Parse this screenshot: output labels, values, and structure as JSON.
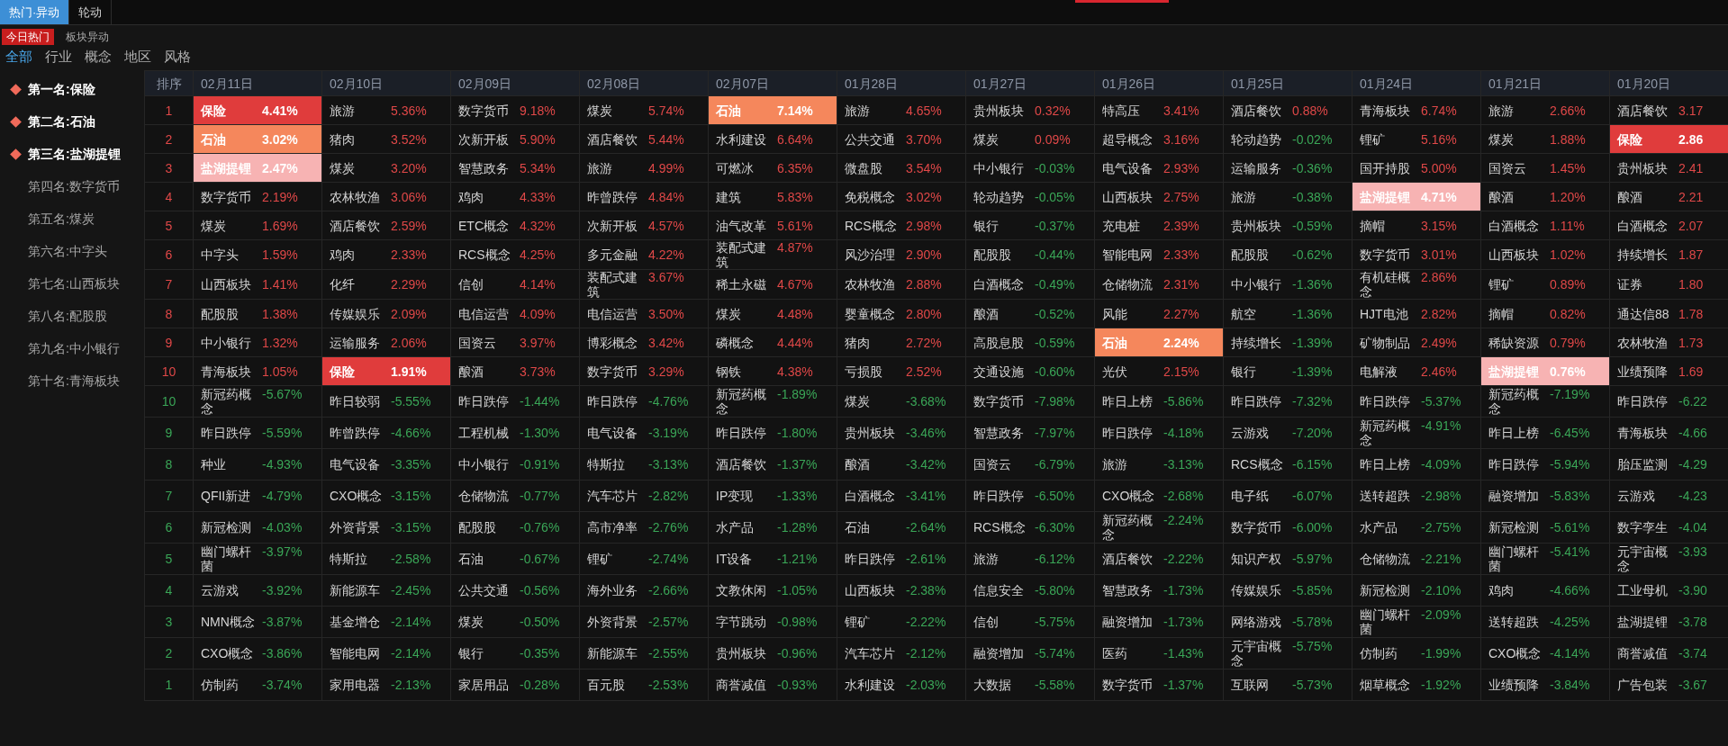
{
  "top_tabs": [
    {
      "label": "热门·异动",
      "selected": true
    },
    {
      "label": "轮动",
      "selected": false
    }
  ],
  "sub_tabs": [
    {
      "label": "今日热门",
      "selected": true
    },
    {
      "label": "板块异动",
      "selected": false
    }
  ],
  "filters": [
    {
      "label": "全部",
      "selected": true
    },
    {
      "label": "行业",
      "selected": false
    },
    {
      "label": "概念",
      "selected": false
    },
    {
      "label": "地区",
      "selected": false
    },
    {
      "label": "风格",
      "selected": false
    }
  ],
  "sidebar": {
    "items": [
      {
        "label": "第一名:保险",
        "highlighted": true
      },
      {
        "label": "第二名:石油",
        "highlighted": true
      },
      {
        "label": "第三名:盐湖提锂",
        "highlighted": true
      },
      {
        "label": "第四名:数字货币",
        "highlighted": false
      },
      {
        "label": "第五名:煤炭",
        "highlighted": false
      },
      {
        "label": "第六名:中字头",
        "highlighted": false
      },
      {
        "label": "第七名:山西板块",
        "highlighted": false
      },
      {
        "label": "第八名:配股股",
        "highlighted": false
      },
      {
        "label": "第九名:中小银行",
        "highlighted": false
      },
      {
        "label": "第十名:青海板块",
        "highlighted": false
      }
    ]
  },
  "table": {
    "rank_header": "排序",
    "columns": [
      "02月11日",
      "02月10日",
      "02月09日",
      "02月08日",
      "02月07日",
      "01月28日",
      "01月27日",
      "01月26日",
      "01月25日",
      "01月24日",
      "01月21日",
      "01月20日"
    ],
    "rows": [
      {
        "rank": "1",
        "kind": "gain",
        "cells": [
          {
            "name": "保险",
            "change": "4.41%",
            "color": "#e03c3c"
          },
          {
            "name": "旅游",
            "change": "5.36%",
            "rise": true
          },
          {
            "name": "数字货币",
            "change": "9.18%",
            "rise": true
          },
          {
            "name": "煤炭",
            "change": "5.74%",
            "rise": true
          },
          {
            "name": "石油",
            "change": "7.14%",
            "color": "#f5875c"
          },
          {
            "name": "旅游",
            "change": "4.65%",
            "rise": true
          },
          {
            "name": "贵州板块",
            "change": "0.32%",
            "rise": true
          },
          {
            "name": "特高压",
            "change": "3.41%",
            "rise": true
          },
          {
            "name": "酒店餐饮",
            "change": "0.88%",
            "rise": true
          },
          {
            "name": "青海板块",
            "change": "6.74%",
            "rise": true
          },
          {
            "name": "旅游",
            "change": "2.66%",
            "rise": true
          },
          {
            "name": "酒店餐饮",
            "change": "3.17",
            "rise": true
          }
        ]
      },
      {
        "rank": "2",
        "kind": "gain",
        "cells": [
          {
            "name": "石油",
            "change": "3.02%",
            "color": "#f5875c"
          },
          {
            "name": "猪肉",
            "change": "3.52%",
            "rise": true
          },
          {
            "name": "次新开板",
            "change": "5.90%",
            "rise": true
          },
          {
            "name": "酒店餐饮",
            "change": "5.44%",
            "rise": true
          },
          {
            "name": "水利建设",
            "change": "6.64%",
            "rise": true
          },
          {
            "name": "公共交通",
            "change": "3.70%",
            "rise": true
          },
          {
            "name": "煤炭",
            "change": "0.09%",
            "rise": true
          },
          {
            "name": "超导概念",
            "change": "3.16%",
            "rise": true
          },
          {
            "name": "轮动趋势",
            "change": "-0.02%",
            "rise": false
          },
          {
            "name": "锂矿",
            "change": "5.16%",
            "rise": true
          },
          {
            "name": "煤炭",
            "change": "1.88%",
            "rise": true
          },
          {
            "name": "保险",
            "change": "2.86",
            "color": "#e03c3c"
          }
        ]
      },
      {
        "rank": "3",
        "kind": "gain",
        "cells": [
          {
            "name": "盐湖提锂",
            "change": "2.47%",
            "color": "#f7b3b3"
          },
          {
            "name": "煤炭",
            "change": "3.20%",
            "rise": true
          },
          {
            "name": "智慧政务",
            "change": "5.34%",
            "rise": true
          },
          {
            "name": "旅游",
            "change": "4.99%",
            "rise": true
          },
          {
            "name": "可燃冰",
            "change": "6.35%",
            "rise": true
          },
          {
            "name": "微盘股",
            "change": "3.54%",
            "rise": true
          },
          {
            "name": "中小银行",
            "change": "-0.03%",
            "rise": false
          },
          {
            "name": "电气设备",
            "change": "2.93%",
            "rise": true
          },
          {
            "name": "运输服务",
            "change": "-0.36%",
            "rise": false
          },
          {
            "name": "国开持股",
            "change": "5.00%",
            "rise": true
          },
          {
            "name": "国资云",
            "change": "1.45%",
            "rise": true
          },
          {
            "name": "贵州板块",
            "change": "2.41",
            "rise": true
          }
        ]
      },
      {
        "rank": "4",
        "kind": "gain",
        "cells": [
          {
            "name": "数字货币",
            "change": "2.19%",
            "rise": true
          },
          {
            "name": "农林牧渔",
            "change": "3.06%",
            "rise": true
          },
          {
            "name": "鸡肉",
            "change": "4.33%",
            "rise": true
          },
          {
            "name": "昨曾跌停",
            "change": "4.84%",
            "rise": true
          },
          {
            "name": "建筑",
            "change": "5.83%",
            "rise": true
          },
          {
            "name": "免税概念",
            "change": "3.02%",
            "rise": true
          },
          {
            "name": "轮动趋势",
            "change": "-0.05%",
            "rise": false
          },
          {
            "name": "山西板块",
            "change": "2.75%",
            "rise": true
          },
          {
            "name": "旅游",
            "change": "-0.38%",
            "rise": false
          },
          {
            "name": "盐湖提锂",
            "change": "4.71%",
            "color": "#f7b3b3"
          },
          {
            "name": "酿酒",
            "change": "1.20%",
            "rise": true
          },
          {
            "name": "酿酒",
            "change": "2.21",
            "rise": true
          }
        ]
      },
      {
        "rank": "5",
        "kind": "gain",
        "cells": [
          {
            "name": "煤炭",
            "change": "1.69%",
            "rise": true
          },
          {
            "name": "酒店餐饮",
            "change": "2.59%",
            "rise": true
          },
          {
            "name": "ETC概念",
            "change": "4.32%",
            "rise": true
          },
          {
            "name": "次新开板",
            "change": "4.57%",
            "rise": true
          },
          {
            "name": "油气改革",
            "change": "5.61%",
            "rise": true
          },
          {
            "name": "RCS概念",
            "change": "2.98%",
            "rise": true
          },
          {
            "name": "银行",
            "change": "-0.37%",
            "rise": false
          },
          {
            "name": "充电桩",
            "change": "2.39%",
            "rise": true
          },
          {
            "name": "贵州板块",
            "change": "-0.59%",
            "rise": false
          },
          {
            "name": "摘帽",
            "change": "3.15%",
            "rise": true
          },
          {
            "name": "白酒概念",
            "change": "1.11%",
            "rise": true
          },
          {
            "name": "白酒概念",
            "change": "2.07",
            "rise": true
          }
        ]
      },
      {
        "rank": "6",
        "kind": "gain",
        "cells": [
          {
            "name": "中字头",
            "change": "1.59%",
            "rise": true
          },
          {
            "name": "鸡肉",
            "change": "2.33%",
            "rise": true
          },
          {
            "name": "RCS概念",
            "change": "4.25%",
            "rise": true
          },
          {
            "name": "多元金融",
            "change": "4.22%",
            "rise": true
          },
          {
            "name": "装配式建筑",
            "change": "4.87%",
            "rise": true
          },
          {
            "name": "风沙治理",
            "change": "2.90%",
            "rise": true
          },
          {
            "name": "配股股",
            "change": "-0.44%",
            "rise": false
          },
          {
            "name": "智能电网",
            "change": "2.33%",
            "rise": true
          },
          {
            "name": "配股股",
            "change": "-0.62%",
            "rise": false
          },
          {
            "name": "数字货币",
            "change": "3.01%",
            "rise": true
          },
          {
            "name": "山西板块",
            "change": "1.02%",
            "rise": true
          },
          {
            "name": "持续增长",
            "change": "1.87",
            "rise": true
          }
        ]
      },
      {
        "rank": "7",
        "kind": "gain",
        "cells": [
          {
            "name": "山西板块",
            "change": "1.41%",
            "rise": true
          },
          {
            "name": "化纤",
            "change": "2.29%",
            "rise": true
          },
          {
            "name": "信创",
            "change": "4.14%",
            "rise": true
          },
          {
            "name": "装配式建筑",
            "change": "3.67%",
            "rise": true
          },
          {
            "name": "稀土永磁",
            "change": "4.67%",
            "rise": true
          },
          {
            "name": "农林牧渔",
            "change": "2.88%",
            "rise": true
          },
          {
            "name": "白酒概念",
            "change": "-0.49%",
            "rise": false
          },
          {
            "name": "仓储物流",
            "change": "2.31%",
            "rise": true
          },
          {
            "name": "中小银行",
            "change": "-1.36%",
            "rise": false
          },
          {
            "name": "有机硅概念",
            "change": "2.86%",
            "rise": true
          },
          {
            "name": "锂矿",
            "change": "0.89%",
            "rise": true
          },
          {
            "name": "证券",
            "change": "1.80",
            "rise": true
          }
        ]
      },
      {
        "rank": "8",
        "kind": "gain",
        "cells": [
          {
            "name": "配股股",
            "change": "1.38%",
            "rise": true
          },
          {
            "name": "传媒娱乐",
            "change": "2.09%",
            "rise": true
          },
          {
            "name": "电信运营",
            "change": "4.09%",
            "rise": true
          },
          {
            "name": "电信运营",
            "change": "3.50%",
            "rise": true
          },
          {
            "name": "煤炭",
            "change": "4.48%",
            "rise": true
          },
          {
            "name": "婴童概念",
            "change": "2.80%",
            "rise": true
          },
          {
            "name": "酿酒",
            "change": "-0.52%",
            "rise": false
          },
          {
            "name": "风能",
            "change": "2.27%",
            "rise": true
          },
          {
            "name": "航空",
            "change": "-1.36%",
            "rise": false
          },
          {
            "name": "HJT电池",
            "change": "2.82%",
            "rise": true
          },
          {
            "name": "摘帽",
            "change": "0.82%",
            "rise": true
          },
          {
            "name": "通达信88",
            "change": "1.78",
            "rise": true
          }
        ]
      },
      {
        "rank": "9",
        "kind": "gain",
        "cells": [
          {
            "name": "中小银行",
            "change": "1.32%",
            "rise": true
          },
          {
            "name": "运输服务",
            "change": "2.06%",
            "rise": true
          },
          {
            "name": "国资云",
            "change": "3.97%",
            "rise": true
          },
          {
            "name": "博彩概念",
            "change": "3.42%",
            "rise": true
          },
          {
            "name": "磷概念",
            "change": "4.44%",
            "rise": true
          },
          {
            "name": "猪肉",
            "change": "2.72%",
            "rise": true
          },
          {
            "name": "高股息股",
            "change": "-0.59%",
            "rise": false
          },
          {
            "name": "石油",
            "change": "2.24%",
            "color": "#f5875c"
          },
          {
            "name": "持续增长",
            "change": "-1.39%",
            "rise": false
          },
          {
            "name": "矿物制品",
            "change": "2.49%",
            "rise": true
          },
          {
            "name": "稀缺资源",
            "change": "0.79%",
            "rise": true
          },
          {
            "name": "农林牧渔",
            "change": "1.73",
            "rise": true
          }
        ]
      },
      {
        "rank": "10",
        "kind": "gain",
        "cells": [
          {
            "name": "青海板块",
            "change": "1.05%",
            "rise": true
          },
          {
            "name": "保险",
            "change": "1.91%",
            "color": "#e03c3c"
          },
          {
            "name": "酿酒",
            "change": "3.73%",
            "rise": true
          },
          {
            "name": "数字货币",
            "change": "3.29%",
            "rise": true
          },
          {
            "name": "钢铁",
            "change": "4.38%",
            "rise": true
          },
          {
            "name": "亏损股",
            "change": "2.52%",
            "rise": true
          },
          {
            "name": "交通设施",
            "change": "-0.60%",
            "rise": false
          },
          {
            "name": "光伏",
            "change": "2.15%",
            "rise": true
          },
          {
            "name": "银行",
            "change": "-1.39%",
            "rise": false
          },
          {
            "name": "电解液",
            "change": "2.46%",
            "rise": true
          },
          {
            "name": "盐湖提锂",
            "change": "0.76%",
            "color": "#f7b3b3"
          },
          {
            "name": "业绩预降",
            "change": "1.69",
            "rise": true
          }
        ]
      },
      {
        "rank": "10",
        "kind": "loss",
        "cells": [
          {
            "name": "新冠药概念",
            "change": "-5.67%",
            "rise": false
          },
          {
            "name": "昨日较弱",
            "change": "-5.55%",
            "rise": false
          },
          {
            "name": "昨日跌停",
            "change": "-1.44%",
            "rise": false
          },
          {
            "name": "昨日跌停",
            "change": "-4.76%",
            "rise": false
          },
          {
            "name": "新冠药概念",
            "change": "-1.89%",
            "rise": false
          },
          {
            "name": "煤炭",
            "change": "-3.68%",
            "rise": false
          },
          {
            "name": "数字货币",
            "change": "-7.98%",
            "rise": false
          },
          {
            "name": "昨日上榜",
            "change": "-5.86%",
            "rise": false
          },
          {
            "name": "昨日跌停",
            "change": "-7.32%",
            "rise": false
          },
          {
            "name": "昨日跌停",
            "change": "-5.37%",
            "rise": false
          },
          {
            "name": "新冠药概念",
            "change": "-7.19%",
            "rise": false
          },
          {
            "name": "昨日跌停",
            "change": "-6.22",
            "rise": false
          }
        ]
      },
      {
        "rank": "9",
        "kind": "loss",
        "cells": [
          {
            "name": "昨日跌停",
            "change": "-5.59%",
            "rise": false
          },
          {
            "name": "昨曾跌停",
            "change": "-4.66%",
            "rise": false
          },
          {
            "name": "工程机械",
            "change": "-1.30%",
            "rise": false
          },
          {
            "name": "电气设备",
            "change": "-3.19%",
            "rise": false
          },
          {
            "name": "昨日跌停",
            "change": "-1.80%",
            "rise": false
          },
          {
            "name": "贵州板块",
            "change": "-3.46%",
            "rise": false
          },
          {
            "name": "智慧政务",
            "change": "-7.97%",
            "rise": false
          },
          {
            "name": "昨日跌停",
            "change": "-4.18%",
            "rise": false
          },
          {
            "name": "云游戏",
            "change": "-7.20%",
            "rise": false
          },
          {
            "name": "新冠药概念",
            "change": "-4.91%",
            "rise": false
          },
          {
            "name": "昨日上榜",
            "change": "-6.45%",
            "rise": false
          },
          {
            "name": "青海板块",
            "change": "-4.66",
            "rise": false
          }
        ]
      },
      {
        "rank": "8",
        "kind": "loss",
        "cells": [
          {
            "name": "种业",
            "change": "-4.93%",
            "rise": false
          },
          {
            "name": "电气设备",
            "change": "-3.35%",
            "rise": false
          },
          {
            "name": "中小银行",
            "change": "-0.91%",
            "rise": false
          },
          {
            "name": "特斯拉",
            "change": "-3.13%",
            "rise": false
          },
          {
            "name": "酒店餐饮",
            "change": "-1.37%",
            "rise": false
          },
          {
            "name": "酿酒",
            "change": "-3.42%",
            "rise": false
          },
          {
            "name": "国资云",
            "change": "-6.79%",
            "rise": false
          },
          {
            "name": "旅游",
            "change": "-3.13%",
            "rise": false
          },
          {
            "name": "RCS概念",
            "change": "-6.15%",
            "rise": false
          },
          {
            "name": "昨日上榜",
            "change": "-4.09%",
            "rise": false
          },
          {
            "name": "昨日跌停",
            "change": "-5.94%",
            "rise": false
          },
          {
            "name": "胎压监测",
            "change": "-4.29",
            "rise": false
          }
        ]
      },
      {
        "rank": "7",
        "kind": "loss",
        "cells": [
          {
            "name": "QFII新进",
            "change": "-4.79%",
            "rise": false
          },
          {
            "name": "CXO概念",
            "change": "-3.15%",
            "rise": false
          },
          {
            "name": "仓储物流",
            "change": "-0.77%",
            "rise": false
          },
          {
            "name": "汽车芯片",
            "change": "-2.82%",
            "rise": false
          },
          {
            "name": "IP变现",
            "change": "-1.33%",
            "rise": false
          },
          {
            "name": "白酒概念",
            "change": "-3.41%",
            "rise": false
          },
          {
            "name": "昨日跌停",
            "change": "-6.50%",
            "rise": false
          },
          {
            "name": "CXO概念",
            "change": "-2.68%",
            "rise": false
          },
          {
            "name": "电子纸",
            "change": "-6.07%",
            "rise": false
          },
          {
            "name": "送转超跌",
            "change": "-2.98%",
            "rise": false
          },
          {
            "name": "融资增加",
            "change": "-5.83%",
            "rise": false
          },
          {
            "name": "云游戏",
            "change": "-4.23",
            "rise": false
          }
        ]
      },
      {
        "rank": "6",
        "kind": "loss",
        "cells": [
          {
            "name": "新冠检测",
            "change": "-4.03%",
            "rise": false
          },
          {
            "name": "外资背景",
            "change": "-3.15%",
            "rise": false
          },
          {
            "name": "配股股",
            "change": "-0.76%",
            "rise": false
          },
          {
            "name": "高市净率",
            "change": "-2.76%",
            "rise": false
          },
          {
            "name": "水产品",
            "change": "-1.28%",
            "rise": false
          },
          {
            "name": "石油",
            "change": "-2.64%",
            "rise": false
          },
          {
            "name": "RCS概念",
            "change": "-6.30%",
            "rise": false
          },
          {
            "name": "新冠药概念",
            "change": "-2.24%",
            "rise": false
          },
          {
            "name": "数字货币",
            "change": "-6.00%",
            "rise": false
          },
          {
            "name": "水产品",
            "change": "-2.75%",
            "rise": false
          },
          {
            "name": "新冠检测",
            "change": "-5.61%",
            "rise": false
          },
          {
            "name": "数字孪生",
            "change": "-4.04",
            "rise": false
          }
        ]
      },
      {
        "rank": "5",
        "kind": "loss",
        "cells": [
          {
            "name": "幽门螺杆菌",
            "change": "-3.97%",
            "rise": false
          },
          {
            "name": "特斯拉",
            "change": "-2.58%",
            "rise": false
          },
          {
            "name": "石油",
            "change": "-0.67%",
            "rise": false
          },
          {
            "name": "锂矿",
            "change": "-2.74%",
            "rise": false
          },
          {
            "name": "IT设备",
            "change": "-1.21%",
            "rise": false
          },
          {
            "name": "昨日跌停",
            "change": "-2.61%",
            "rise": false
          },
          {
            "name": "旅游",
            "change": "-6.12%",
            "rise": false
          },
          {
            "name": "酒店餐饮",
            "change": "-2.22%",
            "rise": false
          },
          {
            "name": "知识产权",
            "change": "-5.97%",
            "rise": false
          },
          {
            "name": "仓储物流",
            "change": "-2.21%",
            "rise": false
          },
          {
            "name": "幽门螺杆菌",
            "change": "-5.41%",
            "rise": false
          },
          {
            "name": "元宇宙概念",
            "change": "-3.93",
            "rise": false
          }
        ]
      },
      {
        "rank": "4",
        "kind": "loss",
        "cells": [
          {
            "name": "云游戏",
            "change": "-3.92%",
            "rise": false
          },
          {
            "name": "新能源车",
            "change": "-2.45%",
            "rise": false
          },
          {
            "name": "公共交通",
            "change": "-0.56%",
            "rise": false
          },
          {
            "name": "海外业务",
            "change": "-2.66%",
            "rise": false
          },
          {
            "name": "文教休闲",
            "change": "-1.05%",
            "rise": false
          },
          {
            "name": "山西板块",
            "change": "-2.38%",
            "rise": false
          },
          {
            "name": "信息安全",
            "change": "-5.80%",
            "rise": false
          },
          {
            "name": "智慧政务",
            "change": "-1.73%",
            "rise": false
          },
          {
            "name": "传媒娱乐",
            "change": "-5.85%",
            "rise": false
          },
          {
            "name": "新冠检测",
            "change": "-2.10%",
            "rise": false
          },
          {
            "name": "鸡肉",
            "change": "-4.66%",
            "rise": false
          },
          {
            "name": "工业母机",
            "change": "-3.90",
            "rise": false
          }
        ]
      },
      {
        "rank": "3",
        "kind": "loss",
        "cells": [
          {
            "name": "NMN概念",
            "change": "-3.87%",
            "rise": false
          },
          {
            "name": "基金增仓",
            "change": "-2.14%",
            "rise": false
          },
          {
            "name": "煤炭",
            "change": "-0.50%",
            "rise": false
          },
          {
            "name": "外资背景",
            "change": "-2.57%",
            "rise": false
          },
          {
            "name": "字节跳动",
            "change": "-0.98%",
            "rise": false
          },
          {
            "name": "锂矿",
            "change": "-2.22%",
            "rise": false
          },
          {
            "name": "信创",
            "change": "-5.75%",
            "rise": false
          },
          {
            "name": "融资增加",
            "change": "-1.73%",
            "rise": false
          },
          {
            "name": "网络游戏",
            "change": "-5.78%",
            "rise": false
          },
          {
            "name": "幽门螺杆菌",
            "change": "-2.09%",
            "rise": false
          },
          {
            "name": "送转超跌",
            "change": "-4.25%",
            "rise": false
          },
          {
            "name": "盐湖提锂",
            "change": "-3.78",
            "rise": false
          }
        ]
      },
      {
        "rank": "2",
        "kind": "loss",
        "cells": [
          {
            "name": "CXO概念",
            "change": "-3.86%",
            "rise": false
          },
          {
            "name": "智能电网",
            "change": "-2.14%",
            "rise": false
          },
          {
            "name": "银行",
            "change": "-0.35%",
            "rise": false
          },
          {
            "name": "新能源车",
            "change": "-2.55%",
            "rise": false
          },
          {
            "name": "贵州板块",
            "change": "-0.96%",
            "rise": false
          },
          {
            "name": "汽车芯片",
            "change": "-2.12%",
            "rise": false
          },
          {
            "name": "融资增加",
            "change": "-5.74%",
            "rise": false
          },
          {
            "name": "医药",
            "change": "-1.43%",
            "rise": false
          },
          {
            "name": "元宇宙概念",
            "change": "-5.75%",
            "rise": false
          },
          {
            "name": "仿制药",
            "change": "-1.99%",
            "rise": false
          },
          {
            "name": "CXO概念",
            "change": "-4.14%",
            "rise": false
          },
          {
            "name": "商誉减值",
            "change": "-3.74",
            "rise": false
          }
        ]
      },
      {
        "rank": "1",
        "kind": "loss",
        "cells": [
          {
            "name": "仿制药",
            "change": "-3.74%",
            "rise": false
          },
          {
            "name": "家用电器",
            "change": "-2.13%",
            "rise": false
          },
          {
            "name": "家居用品",
            "change": "-0.28%",
            "rise": false
          },
          {
            "name": "百元股",
            "change": "-2.53%",
            "rise": false
          },
          {
            "name": "商誉减值",
            "change": "-0.93%",
            "rise": false
          },
          {
            "name": "水利建设",
            "change": "-2.03%",
            "rise": false
          },
          {
            "name": "大数据",
            "change": "-5.58%",
            "rise": false
          },
          {
            "name": "数字货币",
            "change": "-1.37%",
            "rise": false
          },
          {
            "name": "互联网",
            "change": "-5.73%",
            "rise": false
          },
          {
            "name": "烟草概念",
            "change": "-1.92%",
            "rise": false
          },
          {
            "name": "业绩预降",
            "change": "-3.84%",
            "rise": false
          },
          {
            "name": "广告包装",
            "change": "-3.67",
            "rise": false
          }
        ]
      }
    ]
  }
}
